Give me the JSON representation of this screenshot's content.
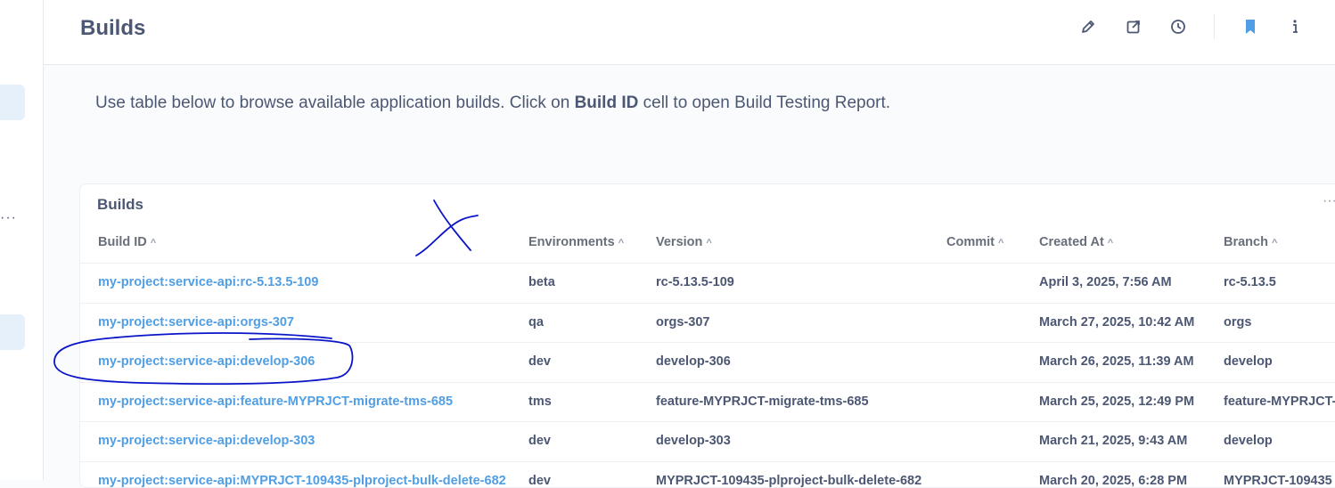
{
  "header": {
    "title": "Builds",
    "icons": [
      "pencil-icon",
      "external-link-icon",
      "clock-icon",
      "bookmark-icon",
      "info-icon",
      "more-icon"
    ]
  },
  "intro": {
    "before": "Use table below to browse available application builds. Click on ",
    "bold": "Build ID",
    "after": " cell to open Build Testing Report."
  },
  "card": {
    "title": "Builds",
    "menu": "···",
    "columns": [
      {
        "key": "build_id",
        "label": "Build ID"
      },
      {
        "key": "environments",
        "label": "Environments"
      },
      {
        "key": "version",
        "label": "Version"
      },
      {
        "key": "commit",
        "label": "Commit"
      },
      {
        "key": "created_at",
        "label": "Created At"
      },
      {
        "key": "branch",
        "label": "Branch"
      }
    ],
    "sort_glyph": "^",
    "rows": [
      {
        "build_id": "my-project:service-api:rc-5.13.5-109",
        "environments": "beta",
        "version": "rc-5.13.5-109",
        "commit": "",
        "created_at": "April 3, 2025, 7:56 AM",
        "branch": "rc-5.13.5"
      },
      {
        "build_id": "my-project:service-api:orgs-307",
        "environments": "qa",
        "version": "orgs-307",
        "commit": "",
        "created_at": "March 27, 2025, 10:42 AM",
        "branch": "orgs"
      },
      {
        "build_id": "my-project:service-api:develop-306",
        "environments": "dev",
        "version": "develop-306",
        "commit": "",
        "created_at": "March 26, 2025, 11:39 AM",
        "branch": "develop"
      },
      {
        "build_id": "my-project:service-api:feature-MYPRJCT-migrate-tms-685",
        "environments": "tms",
        "version": "feature-MYPRJCT-migrate-tms-685",
        "commit": "",
        "created_at": "March 25, 2025, 12:49 PM",
        "branch": "feature-MYPRJCT-"
      },
      {
        "build_id": "my-project:service-api:develop-303",
        "environments": "dev",
        "version": "develop-303",
        "commit": "",
        "created_at": "March 21, 2025, 9:43 AM",
        "branch": "develop"
      },
      {
        "build_id": "my-project:service-api:MYPRJCT-109435-plproject-bulk-delete-682",
        "environments": "dev",
        "version": "MYPRJCT-109435-plproject-bulk-delete-682",
        "commit": "",
        "created_at": "March 20, 2025, 6:28 PM",
        "branch": "MYPRJCT-109435"
      }
    ]
  },
  "colors": {
    "accent": "#509ee3",
    "text": "#4c5773",
    "annotation": "#0a14c8"
  }
}
